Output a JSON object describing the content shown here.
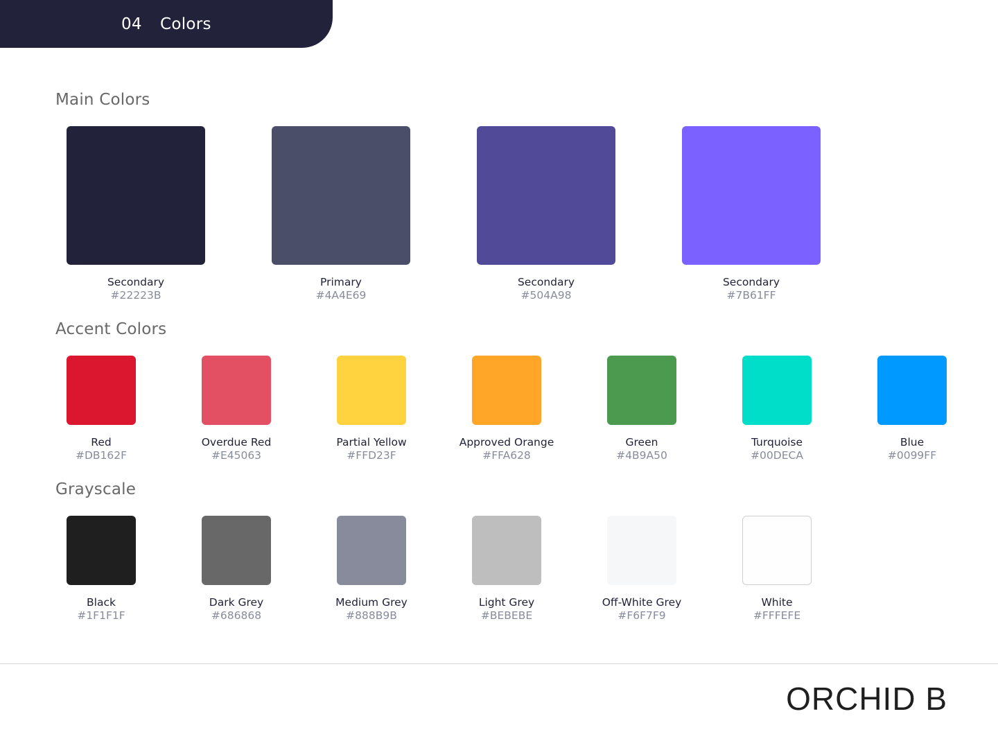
{
  "header": {
    "number": "04",
    "title": "Colors"
  },
  "sections": {
    "main": {
      "title": "Main Colors",
      "items": [
        {
          "name": "Secondary",
          "hex": "#22223B",
          "color": "#22223B"
        },
        {
          "name": "Primary",
          "hex": "#4A4E69",
          "color": "#4A4E69"
        },
        {
          "name": "Secondary",
          "hex": "#504A98",
          "color": "#504A98"
        },
        {
          "name": "Secondary",
          "hex": "#7B61FF",
          "color": "#7B61FF"
        }
      ]
    },
    "accent": {
      "title": "Accent Colors",
      "items": [
        {
          "name": "Red",
          "hex": "#DB162F",
          "color": "#DB162F"
        },
        {
          "name": "Overdue Red",
          "hex": "#E45063",
          "color": "#E45063"
        },
        {
          "name": "Partial Yellow",
          "hex": "#FFD23F",
          "color": "#FFD23F"
        },
        {
          "name": "Approved Orange",
          "hex": "#FFA628",
          "color": "#FFA628"
        },
        {
          "name": "Green",
          "hex": "#4B9A50",
          "color": "#4B9A50"
        },
        {
          "name": "Turquoise",
          "hex": "#00DECA",
          "color": "#00DECA"
        },
        {
          "name": "Blue",
          "hex": "#0099FF",
          "color": "#0099FF"
        }
      ]
    },
    "grayscale": {
      "title": "Grayscale",
      "items": [
        {
          "name": "Black",
          "hex": "#1F1F1F",
          "color": "#1F1F1F"
        },
        {
          "name": "Dark Grey",
          "hex": "#686868",
          "color": "#686868"
        },
        {
          "name": "Medium Grey",
          "hex": "#888B9B",
          "color": "#888B9B"
        },
        {
          "name": "Light Grey",
          "hex": "#BEBEBE",
          "color": "#BEBEBE"
        },
        {
          "name": "Off-White Grey",
          "hex": "#F6F7F9",
          "color": "#F6F7F9"
        },
        {
          "name": "White",
          "hex": "#FFFEFE",
          "color": "#FFFEFE"
        }
      ]
    }
  },
  "footer": {
    "brand": "ORCHID B"
  }
}
